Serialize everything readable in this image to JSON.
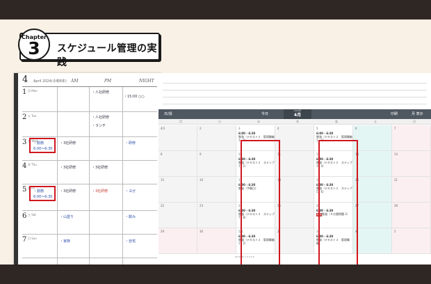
{
  "chapter": {
    "word": "Chapter",
    "number": "3",
    "title": "スケジュール管理の実践"
  },
  "planner": {
    "month": "4",
    "subtitle": "April 2024(令和6年)",
    "columns": [
      "AM",
      "PM",
      "NIGHT"
    ],
    "days": [
      {
        "num": "1",
        "dow": "月 Mon"
      },
      {
        "num": "2",
        "dow": "火 Tue"
      },
      {
        "num": "3",
        "dow": "水 Wed"
      },
      {
        "num": "4",
        "dow": "木 Thu"
      },
      {
        "num": "5",
        "dow": "金 Fri"
      },
      {
        "num": "6",
        "dow": "土 Sat"
      },
      {
        "num": "7",
        "dow": "日 Sun"
      }
    ],
    "notes": {
      "d1_pm": "・人社研修",
      "d1_night": "・15:00 ○○",
      "d2_pm": "・人社研修",
      "d2_pm2": "・ランチ",
      "d3_am": "・勤務",
      "d3_am_time": "6:00〜6:30",
      "d3_pm": "・3社研修",
      "d3_night": "・研修",
      "d4_am": "・3社研修",
      "d4_pm": "・3社研修",
      "d5_am": "・勤務",
      "d5_am_time": "6:00〜6:30",
      "d5_am2": "・3社研修",
      "d5_pm": "・3社研修",
      "d5_night": "・ヨガ",
      "d6_am": "・山登り",
      "d6_night": "・飲み",
      "d7_am": "・家族",
      "d7_night": "・自宅"
    }
  },
  "calendar": {
    "toolbar": {
      "view_label": "日/週",
      "today_label": "今日",
      "year": "2024年",
      "month": "4月",
      "print_label": "印刷",
      "display_label": "月 表示"
    },
    "weekdays": [
      "月",
      "火",
      "水",
      "木",
      "金",
      "土",
      "日"
    ],
    "rows": [
      [
        "4/1",
        "2",
        "3",
        "4",
        "5",
        "6",
        "7"
      ],
      [
        "8",
        "9",
        "10",
        "11",
        "12",
        "13",
        "14"
      ],
      [
        "15",
        "16",
        "17",
        "18",
        "19",
        "20",
        "21"
      ],
      [
        "22",
        "23",
        "24",
        "25",
        "26",
        "27",
        "28"
      ],
      [
        "29",
        "30",
        "5/1",
        "2",
        "3",
        "4",
        "5"
      ]
    ],
    "wed_events": [
      {
        "time": "6:00 - 6:30",
        "text": "勉強（テキスト２　管理職編 1・2）"
      },
      {
        "time": "6:00 - 6:30",
        "text": "勉強（テキスト２　ステップ 1・2）"
      },
      {
        "time": "6:00 - 6:30",
        "text": "勉強（予備日）"
      },
      {
        "time": "6:00 - 6:30",
        "text": "勉強（テキスト２　ステップ 7・8）"
      },
      {
        "time": "6:00 - 6:30",
        "text": "勉強（テキスト２　管理職編 1・2）"
      }
    ],
    "fri_events": [
      {
        "time": "6:00 - 6:30",
        "text": "勉強（テキスト２　管理職編 1・2）"
      },
      {
        "time": "6:00 - 6:30",
        "text": "勉強（テキスト２　ステップ 3・4）"
      },
      {
        "time": "6:00 - 6:30",
        "text": "勉強（テキスト２　ステップ 5・6）"
      },
      {
        "time": "6:00 - 6:30",
        "text": "勉強（５分間問題 2）",
        "tag": "模試"
      },
      {
        "time": "6:00 - 6:30",
        "text": "勉強（テキスト２　管理職編）"
      }
    ],
    "mini_calendar": "29 30 31  1  2  3  4  5"
  },
  "colors": {
    "background": "#2e2724",
    "stage": "#faf1e6",
    "highlight": "#d0161e",
    "toolbar": "#4f5861",
    "today_col": "#e4f6f4",
    "sunday_col": "#fbeff1"
  }
}
